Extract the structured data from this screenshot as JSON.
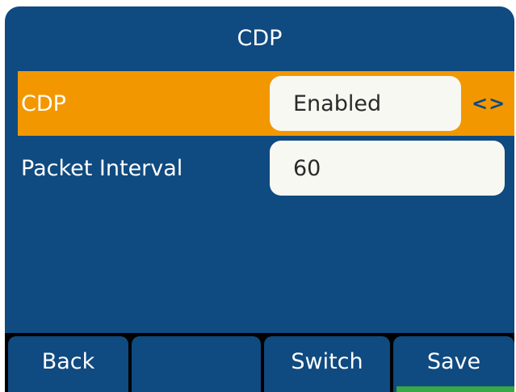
{
  "screen": {
    "title": "CDP"
  },
  "rows": [
    {
      "label": "CDP",
      "value": "Enabled",
      "selected": true,
      "has_arrows": true
    },
    {
      "label": "Packet Interval",
      "value": "60",
      "selected": false,
      "has_arrows": false
    }
  ],
  "arrows_glyph": "<>",
  "softkeys": {
    "key1": "Back",
    "key2": "",
    "key3": "Switch",
    "key4": "Save"
  },
  "colors": {
    "background": "#0f4a80",
    "selection": "#f39700",
    "field": "#f8f8f2",
    "active_indicator": "#37a843"
  }
}
